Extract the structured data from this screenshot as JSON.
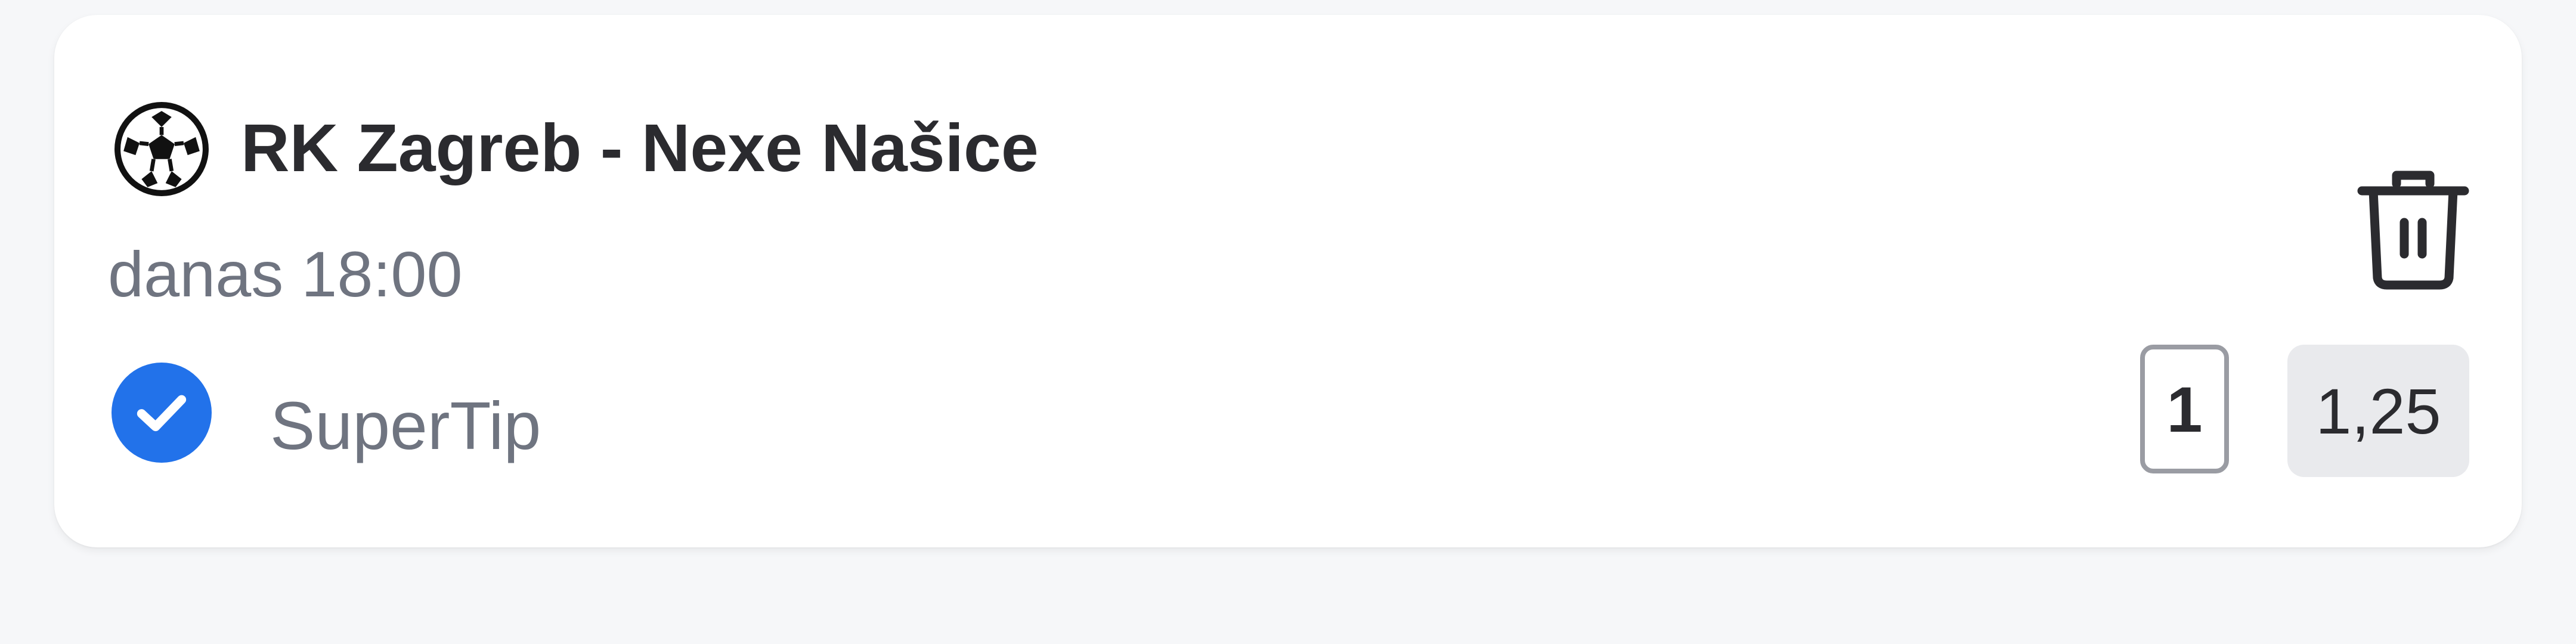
{
  "bet": {
    "sport_icon": "handball-ball-icon",
    "match": "RK Zagreb - Nexe Našice",
    "time": "danas 18:00",
    "tip_status_icon": "check-circle-icon",
    "tip_name": "SuperTip",
    "pick": "1",
    "odds": "1,25",
    "delete_icon": "trash-icon"
  },
  "colors": {
    "background": "#f6f7f9",
    "card": "#ffffff",
    "accent_blue": "#2272ea",
    "title_text": "#2b2b2f",
    "muted_text": "#6f7480",
    "odds_bg": "#e9eaed"
  }
}
